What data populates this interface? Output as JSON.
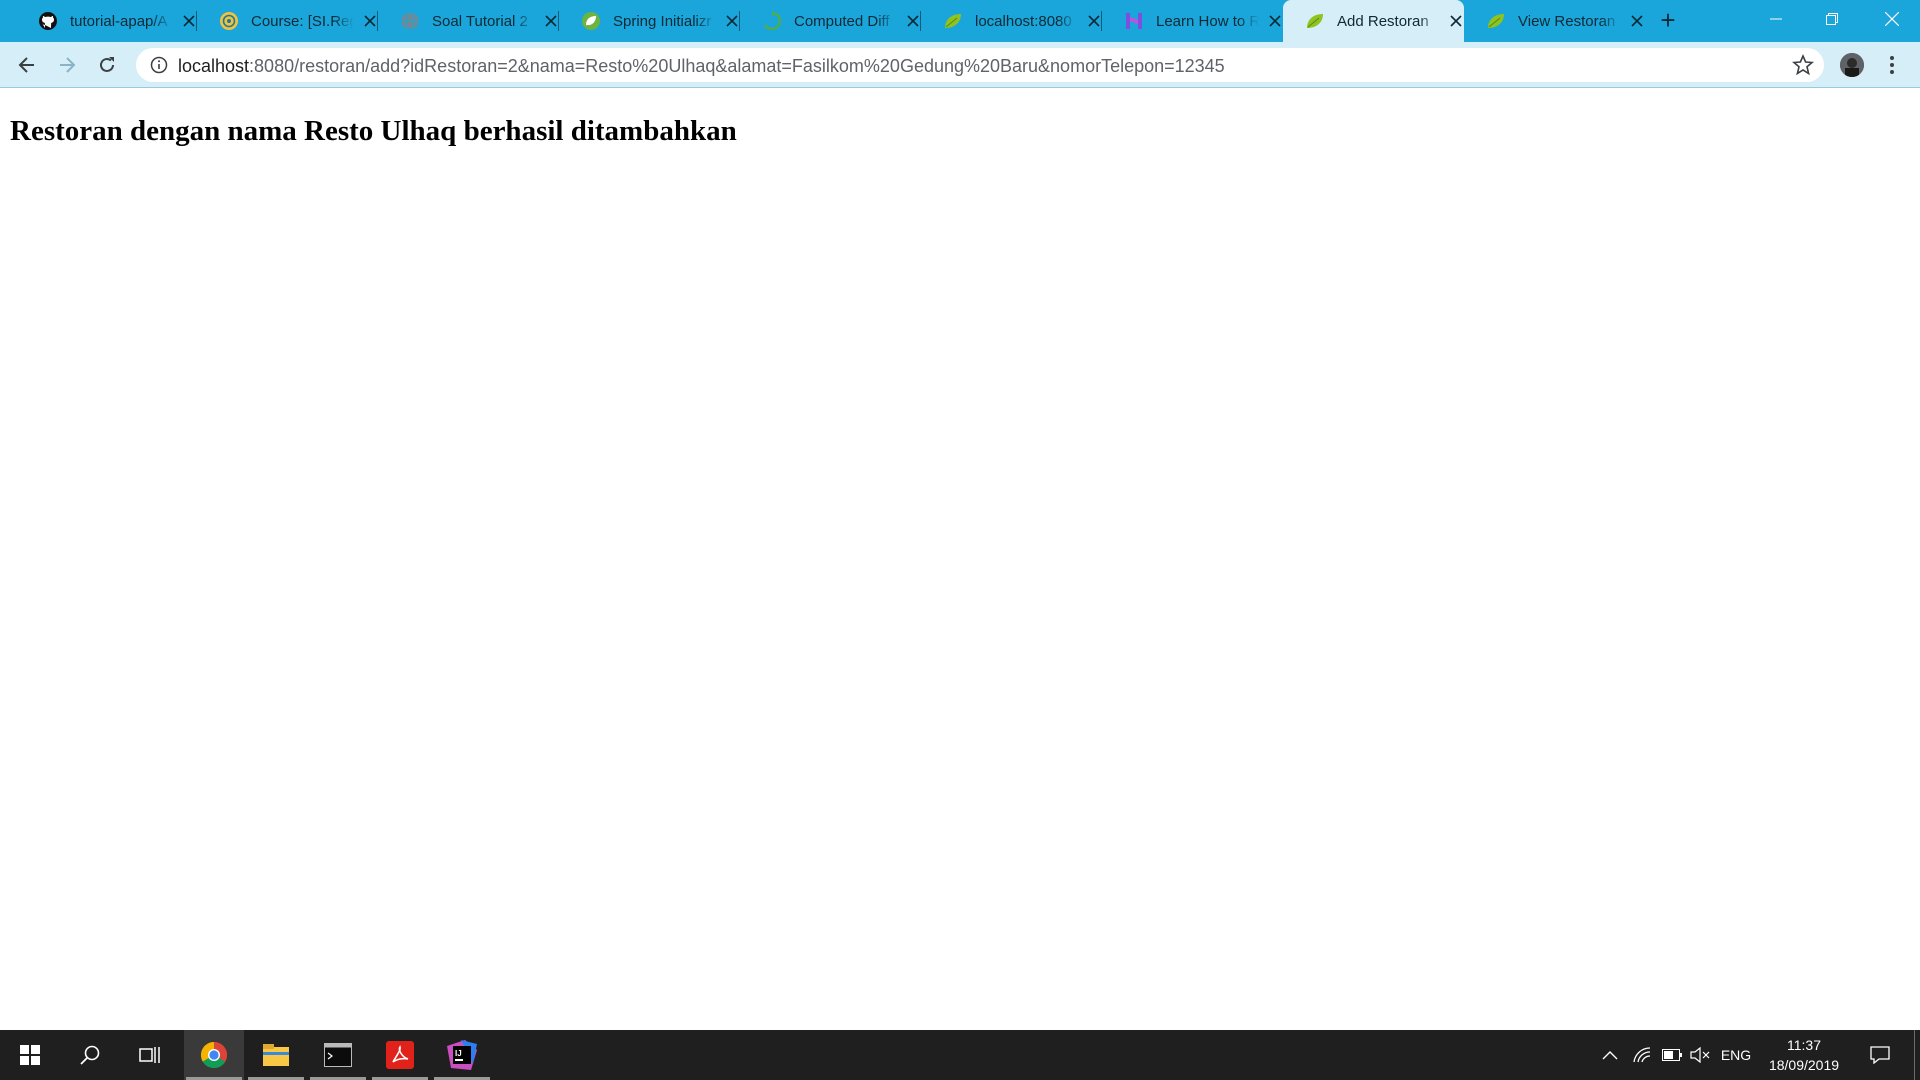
{
  "browser": {
    "tabs": [
      {
        "title": "tutorial-apap/A",
        "favicon": "github-icon",
        "active": false
      },
      {
        "title": "Course: [SI.Reg",
        "favicon": "university-icon",
        "active": false
      },
      {
        "title": "Soal Tutorial 2",
        "favicon": "globe-icon",
        "active": false
      },
      {
        "title": "Spring Initializr",
        "favicon": "spring-icon",
        "active": false
      },
      {
        "title": "Computed Diff",
        "favicon": "diff-icon",
        "active": false
      },
      {
        "title": "localhost:8080",
        "favicon": "leaf-icon",
        "active": false
      },
      {
        "title": "Learn How to R",
        "favicon": "h-icon",
        "active": false
      },
      {
        "title": "Add Restoran",
        "favicon": "leaf-icon",
        "active": true
      },
      {
        "title": "View Restoran",
        "favicon": "leaf-icon",
        "active": false
      }
    ],
    "url": {
      "host": "localhost",
      "rest": ":8080/restoran/add?idRestoran=2&nama=Resto%20Ulhaq&alamat=Fasilkom%20Gedung%20Baru&nomorTelepon=12345"
    },
    "colors": {
      "tabstrip": "#1aa6da",
      "toolbar": "#d6eef7"
    }
  },
  "page": {
    "message": "Restoran dengan nama Resto Ulhaq berhasil ditambahkan"
  },
  "taskbar": {
    "apps": [
      "windows-start-icon",
      "search-icon",
      "task-view-icon",
      "chrome-icon",
      "file-explorer-icon",
      "terminal-icon",
      "acrobat-icon",
      "intellij-icon"
    ],
    "tray": {
      "language": "ENG",
      "time": "11:37",
      "date": "18/09/2019"
    }
  }
}
